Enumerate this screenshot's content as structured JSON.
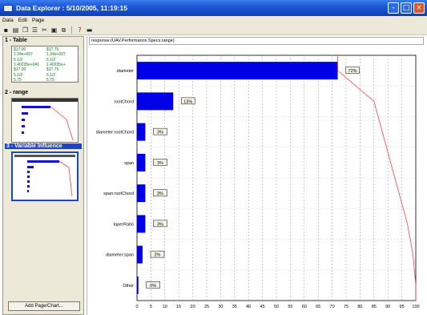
{
  "window": {
    "title": "Data Explorer : 5/10/2005, 11:19:15"
  },
  "menu": [
    "Data",
    "Edit",
    "Page"
  ],
  "toolbar_icons": [
    "save-icon",
    "print-icon",
    "copy-icon",
    "list-icon",
    "cut-icon",
    "paste-icon",
    "duplicate-icon",
    "help-icon",
    "chart-icon"
  ],
  "left_panel": {
    "sections": [
      {
        "label": "1 - Table"
      },
      {
        "label": "2 - range"
      },
      {
        "label": "3 - Variable Influence"
      }
    ],
    "table_cells": [
      [
        "$17.00",
        "$17.75"
      ],
      [
        "1.34e+007",
        "1.34e+007"
      ],
      [
        "5.1/2",
        "5.1/2"
      ],
      [
        "1.40235e+041",
        "1.40235e+"
      ],
      [
        "$17.00",
        "$17.75"
      ],
      [
        "5.1/2",
        "5.1/2"
      ],
      [
        "5.75",
        "5.75"
      ]
    ],
    "add_button": "Add Page/Chart..."
  },
  "response_label": "response:(UAV.Performance.Specs.range)",
  "chart_data": {
    "type": "bar",
    "orientation": "horizontal",
    "categories": [
      "diameter",
      "rootChord",
      "diameter:rootChord",
      "span",
      "span:rootChord",
      "taperRatio",
      "diameter:span",
      "Other"
    ],
    "values": [
      72,
      13,
      3,
      3,
      3,
      3,
      2,
      0.5
    ],
    "data_labels": [
      "72%",
      "13%",
      "3%",
      "3%",
      "3%",
      "3%",
      "2%",
      "0%"
    ],
    "cumulative_line": [
      72,
      85,
      88,
      91,
      94,
      97,
      99,
      100
    ],
    "x_ticks": [
      "0",
      "5",
      "10",
      "15",
      "20",
      "25",
      "30",
      "35",
      "40",
      "45",
      "50",
      "55",
      "60",
      "65",
      "70",
      "75",
      "80",
      "85",
      "90",
      "95",
      "100"
    ],
    "xlim": [
      0,
      100
    ],
    "grid": true,
    "colors": {
      "bar": "#0000e6",
      "cumulative": "#ff4040"
    }
  }
}
